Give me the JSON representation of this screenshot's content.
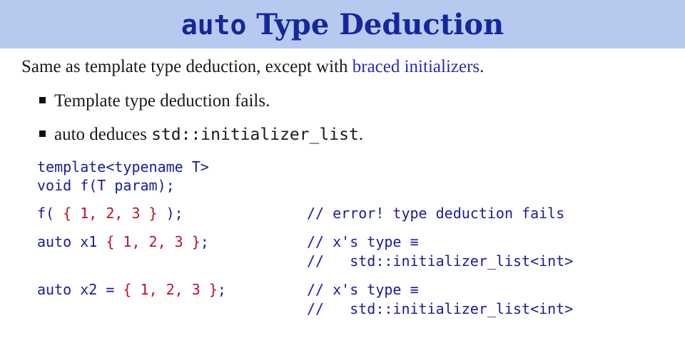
{
  "title": {
    "mono": "auto",
    "rest": " Type Deduction"
  },
  "intro": {
    "text": "Same as template type deduction, except with ",
    "accent": "braced initializers",
    "end": "."
  },
  "bullets": [
    {
      "text": "Template type deduction fails."
    },
    {
      "pre": "auto deduces ",
      "mono": "std::initializer_list",
      "end": "."
    }
  ],
  "code": {
    "line1": "template<typename T>",
    "line2": "void f(T param);",
    "call": {
      "pre": "f( ",
      "braced": "{ 1, 2, 3 }",
      "post": " );",
      "comment": "// error! type deduction fails"
    },
    "x1": {
      "pre": "auto x1 ",
      "braced": "{ 1, 2, 3 }",
      "post": ";",
      "comment1": "// x's type ≡",
      "comment2": "//   std::initializer_list<int>"
    },
    "x2": {
      "pre": "auto x2 = ",
      "braced": "{ 1, 2, 3 }",
      "post": ";",
      "comment1": "// x's type ≡",
      "comment2": "//   std::initializer_list<int>"
    }
  }
}
